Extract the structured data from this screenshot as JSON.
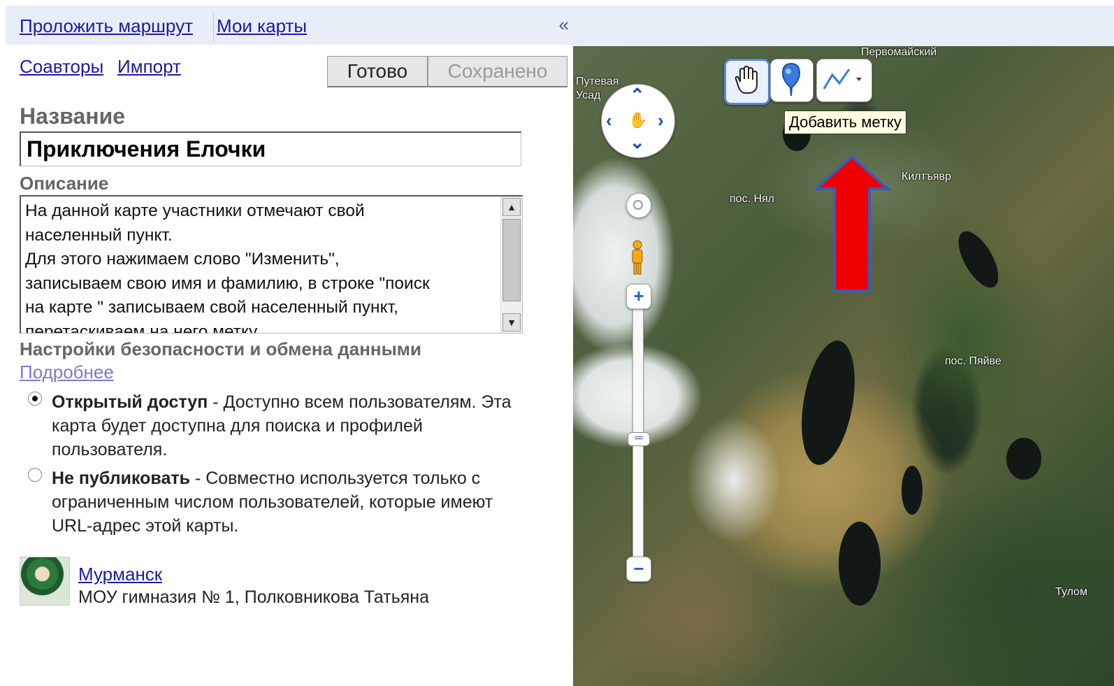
{
  "header": {
    "route_link": "Проложить маршрут",
    "my_maps_link": "Мои карты",
    "collapse_glyph": "«"
  },
  "links": {
    "coauthors": "Соавторы",
    "import": "Импорт"
  },
  "buttons": {
    "done": "Готово",
    "saved": "Сохранено"
  },
  "form": {
    "title_label": "Название",
    "title_value": "Приключения Елочки",
    "description_label": "Описание",
    "description_value": "На данной карте участники отмечают свой\nнаселенный пункт.\nДля этого нажимаем слово \"Изменить\",\nзаписываем свою имя и фамилию, в строке \"поиск\nна карте \" записываем свой населенный пункт,\nперетаскиваем на него метку",
    "privacy_label": "Настройки безопасности и обмена данными",
    "more_link": "Подробнее",
    "privacy_options": [
      {
        "bold": "Открытый доступ",
        "text": " - Доступно всем пользователям. Эта карта будет доступна для поиска и профилей пользователя.",
        "selected": true
      },
      {
        "bold": "Не публиковать",
        "text": " - Совместно используется только с ограниченным числом пользователей, которые имеют URL-адрес этой карты.",
        "selected": false
      }
    ]
  },
  "author": {
    "city_link": "Мурманск",
    "name": "МОУ гимназия № 1, Полковникова Татьяна"
  },
  "map": {
    "labels": {
      "pervomaisky": "Первомайский",
      "putevaya": "Путевая",
      "usad": "Усад",
      "nyal": "пос. Нял",
      "kiltyavr": "Килтъявр",
      "pyaive": "пос. Пяйве",
      "tulom": "Тулом"
    },
    "tooltip": "Добавить метку",
    "zoom_in": "+",
    "zoom_out": "−",
    "tools": [
      "hand-tool",
      "marker-tool",
      "line-tool"
    ]
  },
  "colors": {
    "link": "#1a1aa6",
    "topbar_bg": "#e8eef7",
    "annotation_arrow": "#ee0000",
    "annotation_arrow_border": "#3b5bb8"
  }
}
